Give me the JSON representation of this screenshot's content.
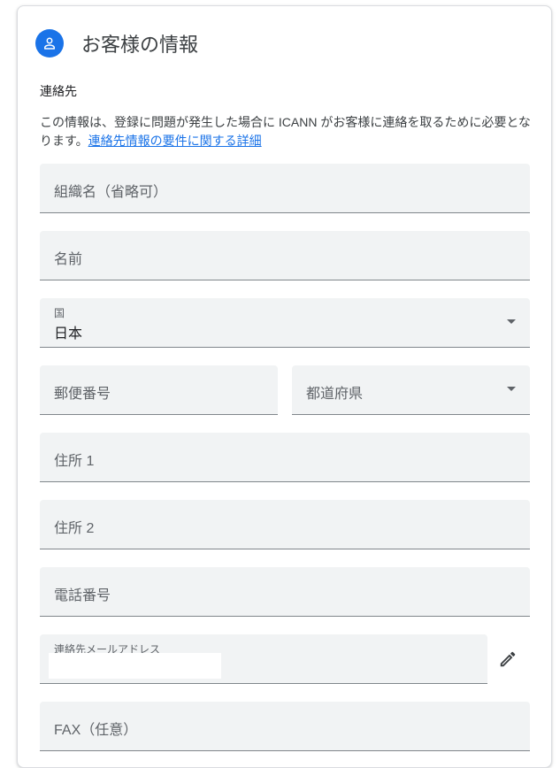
{
  "header": {
    "title": "お客様の情報",
    "icon": "account-icon",
    "accent": "#1a73e8"
  },
  "section": {
    "label": "連絡先",
    "description": "この情報は、登録に問題が発生した場合に ICANN がお客様に連絡を取るために必要となります。",
    "link_text": "連絡先情報の要件に関する詳細"
  },
  "fields": {
    "organization": {
      "placeholder": "組織名（省略可）"
    },
    "name": {
      "placeholder": "名前"
    },
    "country": {
      "label": "国",
      "value": "日本"
    },
    "postal_code": {
      "placeholder": "郵便番号"
    },
    "prefecture": {
      "placeholder": "都道府県"
    },
    "address1": {
      "placeholder": "住所 1"
    },
    "address2": {
      "placeholder": "住所 2"
    },
    "phone": {
      "placeholder": "電話番号"
    },
    "email": {
      "label": "連絡先メールアドレス"
    },
    "fax": {
      "placeholder": "FAX（任意）"
    }
  }
}
